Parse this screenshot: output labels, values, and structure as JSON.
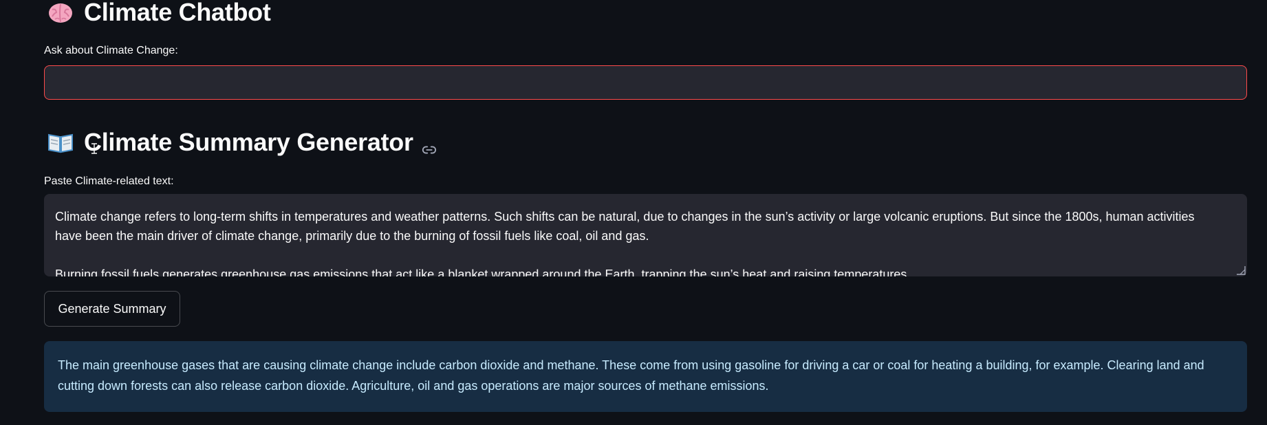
{
  "chatbot": {
    "title": "Climate Chatbot",
    "title_icon": "brain-icon",
    "input_label": "Ask about Climate Change:",
    "input_value": "",
    "input_border_color": "#ff4b4b"
  },
  "summary_generator": {
    "title": "Climate Summary Generator",
    "title_icon": "open-book-icon",
    "anchor_icon": "link-icon",
    "text_label": "Paste Climate-related text:",
    "text_value": "Climate change refers to long-term shifts in temperatures and weather patterns. Such shifts can be natural, due to changes in the sun’s activity or large volcanic eruptions. But since the 1800s, human activities have been the main driver of climate change, primarily due to the burning of fossil fuels like coal, oil and gas.\n\nBurning fossil fuels generates greenhouse gas emissions that act like a blanket wrapped around the Earth, trapping the sun’s heat and raising temperatures.",
    "button_label": "Generate Summary",
    "result_text": "The main greenhouse gases that are causing climate change include carbon dioxide and methane. These come from using gasoline for driving a car or coal for heating a building, for example. Clearing land and cutting down forests can also release carbon dioxide. Agriculture, oil and gas operations are major sources of methane emissions.",
    "result_bg_color": "#172d43",
    "result_text_color": "#c7ebff"
  },
  "colors": {
    "background": "#0e1117",
    "input_bg": "#262730",
    "text": "#fafafa"
  }
}
